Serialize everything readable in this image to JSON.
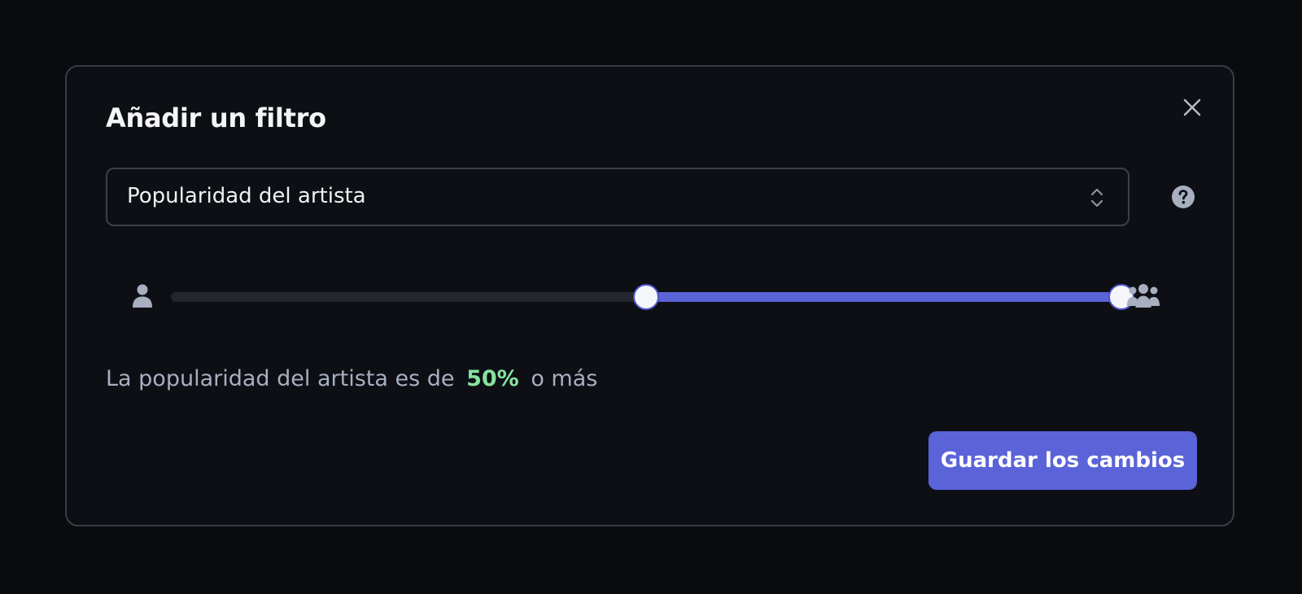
{
  "modal": {
    "title": "Añadir un filtro",
    "close_icon": "close-icon",
    "help_icon": "help-icon"
  },
  "filter_select": {
    "value": "Popularidad del artista",
    "icon": "chevron-up-down-icon"
  },
  "range_slider": {
    "min_icon": "person-icon",
    "max_icon": "group-icon",
    "low_value_percent": 50,
    "high_value_percent": 100
  },
  "summary": {
    "prefix": "La popularidad del artista es de",
    "value": "50%",
    "suffix": "o más"
  },
  "footer": {
    "save_label": "Guardar los cambios"
  },
  "colors": {
    "accent": "#5b63d9",
    "highlight": "#86e29d",
    "background": "#0d0f14",
    "border": "#3a3d45"
  }
}
